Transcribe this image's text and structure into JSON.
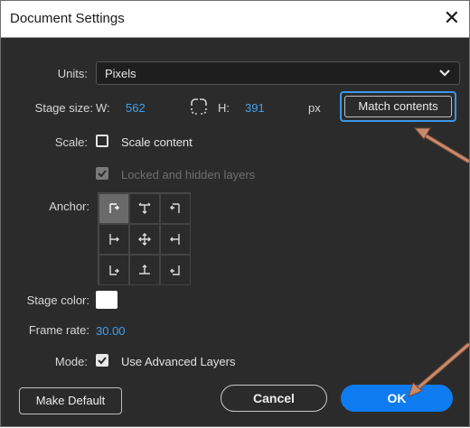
{
  "window": {
    "title": "Document Settings",
    "close_glyph": "✕"
  },
  "units": {
    "label": "Units:",
    "selected": "Pixels"
  },
  "stage_size": {
    "label": "Stage size:",
    "w_label": "W:",
    "width": "562",
    "h_label": "H:",
    "height": "391",
    "unit": "px",
    "link_icon": "link-icon"
  },
  "match_contents": {
    "label": "Match contents"
  },
  "scale": {
    "label": "Scale:",
    "checkbox_label": "Scale content",
    "checked": false
  },
  "locked_layers": {
    "label": "Locked and hidden layers",
    "checked": true,
    "disabled": true
  },
  "anchor": {
    "label": "Anchor:",
    "selected": "top-left"
  },
  "stage_color": {
    "label": "Stage color:",
    "color": "#ffffff"
  },
  "frame_rate": {
    "label": "Frame rate:",
    "value": "30.00"
  },
  "mode": {
    "label": "Mode:",
    "checkbox_label": "Use Advanced Layers",
    "checked": true
  },
  "buttons": {
    "make_default": "Make Default",
    "cancel": "Cancel",
    "ok": "OK"
  },
  "colors": {
    "accent_blue": "#3fa0f0",
    "ok_button": "#0f7bf0",
    "annotation_arrow": "#c98a6b"
  }
}
